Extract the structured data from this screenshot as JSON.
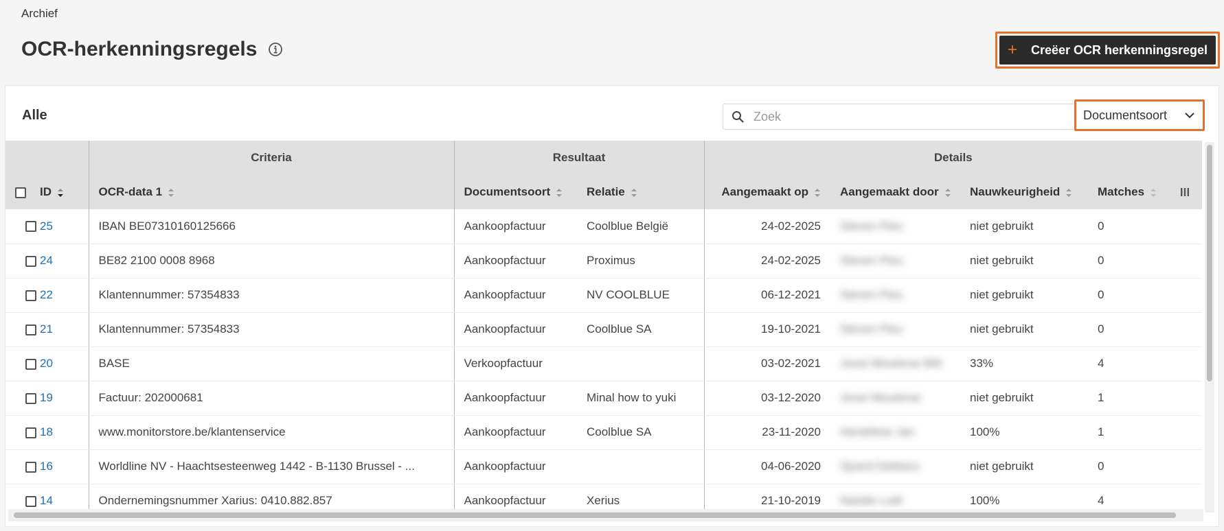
{
  "breadcrumb": "Archief",
  "page_title": "OCR-herkenningsregels",
  "create_button_label": "Creëer OCR herkenningsregel",
  "card_title": "Alle",
  "search": {
    "placeholder": "Zoek"
  },
  "doctype_filter": "Documentsoort",
  "groups": {
    "criteria": "Criteria",
    "resultaat": "Resultaat",
    "details": "Details"
  },
  "columns": {
    "id": "ID",
    "ocr": "OCR-data 1",
    "doc": "Documentsoort",
    "rel": "Relatie",
    "date": "Aangemaakt op",
    "by": "Aangemaakt door",
    "acc": "Nauwkeurigheid",
    "match": "Matches"
  },
  "rows": [
    {
      "id": "25",
      "ocr": "IBAN BE07310160125666",
      "doc": "Aankoopfactuur",
      "rel": "Coolblue België",
      "date": "24-02-2025",
      "by": "Steven Pieu",
      "acc": "niet gebruikt",
      "match": "0"
    },
    {
      "id": "24",
      "ocr": "BE82 2100 0008 8968",
      "doc": "Aankoopfactuur",
      "rel": "Proximus",
      "date": "24-02-2025",
      "by": "Steven Pieu",
      "acc": "niet gebruikt",
      "match": "0"
    },
    {
      "id": "22",
      "ocr": "Klantennummer: 57354833",
      "doc": "Aankoopfactuur",
      "rel": "NV COOLBLUE",
      "date": "06-12-2021",
      "by": "Steven Pieu",
      "acc": "niet gebruikt",
      "match": "0"
    },
    {
      "id": "21",
      "ocr": "Klantennummer: 57354833",
      "doc": "Aankoopfactuur",
      "rel": "Coolblue SA",
      "date": "19-10-2021",
      "by": "Steven Pieu",
      "acc": "niet gebruikt",
      "match": "0"
    },
    {
      "id": "20",
      "ocr": "BASE",
      "doc": "Verkoopfactuur",
      "rel": "",
      "date": "03-02-2021",
      "by": "Joost Wouterse BIK",
      "acc": "33%",
      "match": "4"
    },
    {
      "id": "19",
      "ocr": "Factuur: 202000681",
      "doc": "Aankoopfactuur",
      "rel": "Minal how to yuki",
      "date": "03-12-2020",
      "by": "Joost Wouterse",
      "acc": "niet gebruikt",
      "match": "1"
    },
    {
      "id": "18",
      "ocr": "www.monitorstore.be/klantenservice",
      "doc": "Aankoopfactuur",
      "rel": "Coolblue SA",
      "date": "23-11-2020",
      "by": "Hendrikse Jan",
      "acc": "100%",
      "match": "1"
    },
    {
      "id": "16",
      "ocr": "Worldline NV - Haachtsesteenweg 1442 - B-1130 Brussel - ...",
      "doc": "Aankoopfactuur",
      "rel": "",
      "date": "04-06-2020",
      "by": "Sjoerd Dekkers",
      "acc": "niet gebruikt",
      "match": "0"
    },
    {
      "id": "14",
      "ocr": "Ondernemingsnummer Xarius: 0410.882.857",
      "doc": "Aankoopfactuur",
      "rel": "Xerius",
      "date": "21-10-2019",
      "by": "Natalie Lodt",
      "acc": "100%",
      "match": "4"
    }
  ]
}
